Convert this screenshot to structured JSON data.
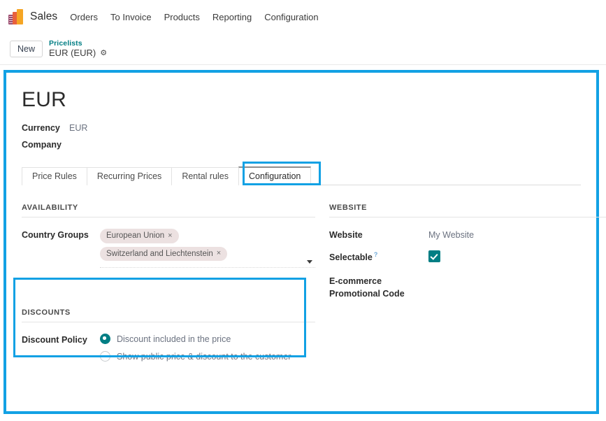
{
  "navbar": {
    "logo_icon": "sales-app-logo-icon",
    "brand": "Sales",
    "items": [
      {
        "label": "Orders"
      },
      {
        "label": "To Invoice"
      },
      {
        "label": "Products"
      },
      {
        "label": "Reporting"
      },
      {
        "label": "Configuration"
      }
    ]
  },
  "control_panel": {
    "new_button": "New",
    "breadcrumb_parent": "Pricelists",
    "breadcrumb_current": "EUR (EUR)",
    "gear_icon": "gear-icon",
    "gear_glyph": "⚙"
  },
  "record": {
    "title": "EUR",
    "fields": [
      {
        "label": "Currency",
        "value": "EUR"
      },
      {
        "label": "Company",
        "value": ""
      }
    ]
  },
  "tabs": [
    {
      "label": "Price Rules",
      "active": false
    },
    {
      "label": "Recurring Prices",
      "active": false
    },
    {
      "label": "Rental rules",
      "active": false
    },
    {
      "label": "Configuration",
      "active": true
    }
  ],
  "availability": {
    "group_title": "AVAILABILITY",
    "country_groups_label": "Country Groups",
    "tags": [
      {
        "label": "European Union",
        "remove_glyph": "×"
      },
      {
        "label": "Switzerland and Liechtenstein",
        "remove_glyph": "×"
      }
    ],
    "dropdown_icon": "chevron-down-icon"
  },
  "website": {
    "group_title": "WEBSITE",
    "website_label": "Website",
    "website_value": "My Website",
    "selectable_label": "Selectable",
    "selectable_help_glyph": "?",
    "selectable_checked": true,
    "promo_code_label": "E-commerce Promotional Code",
    "promo_code_value": ""
  },
  "discounts": {
    "group_title": "DISCOUNTS",
    "policy_label": "Discount Policy",
    "options": [
      {
        "label": "Discount included in the price",
        "selected": true
      },
      {
        "label": "Show public price & discount to the customer",
        "selected": false
      }
    ]
  },
  "colors": {
    "highlight_blue": "#12a1e4",
    "accent_teal": "#017e84",
    "breadcrumb_teal": "#017e84",
    "tag_bg": "#ece1e1"
  }
}
